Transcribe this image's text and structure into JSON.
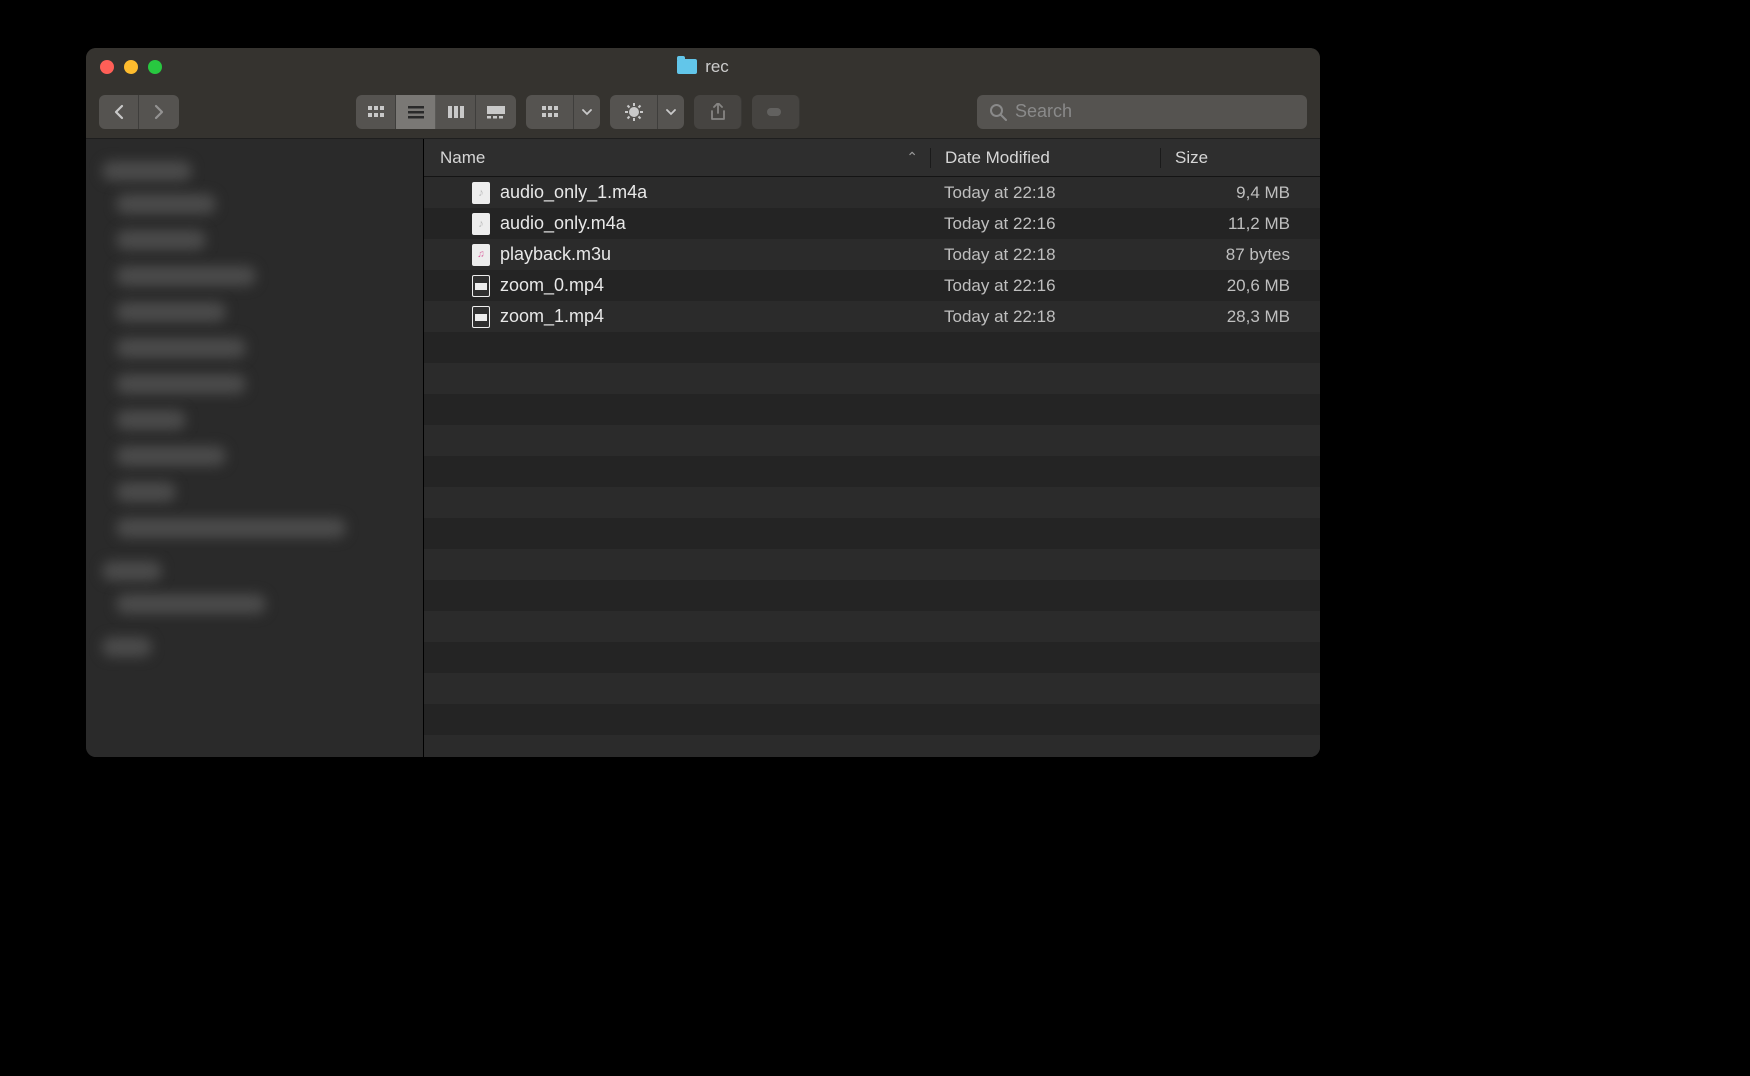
{
  "window": {
    "title": "rec"
  },
  "search": {
    "placeholder": "Search"
  },
  "columns": {
    "name": "Name",
    "date": "Date Modified",
    "size": "Size"
  },
  "files": [
    {
      "name": "audio_only_1.m4a",
      "date": "Today at 22:18",
      "size": "9,4 MB",
      "icon": "audio"
    },
    {
      "name": "audio_only.m4a",
      "date": "Today at 22:16",
      "size": "11,2 MB",
      "icon": "audio"
    },
    {
      "name": "playback.m3u",
      "date": "Today at 22:18",
      "size": "87 bytes",
      "icon": "playlist"
    },
    {
      "name": "zoom_0.mp4",
      "date": "Today at 22:16",
      "size": "20,6 MB",
      "icon": "video"
    },
    {
      "name": "zoom_1.mp4",
      "date": "Today at 22:18",
      "size": "28,3 MB",
      "icon": "video"
    }
  ],
  "sidebar": {
    "items_count": 10
  }
}
